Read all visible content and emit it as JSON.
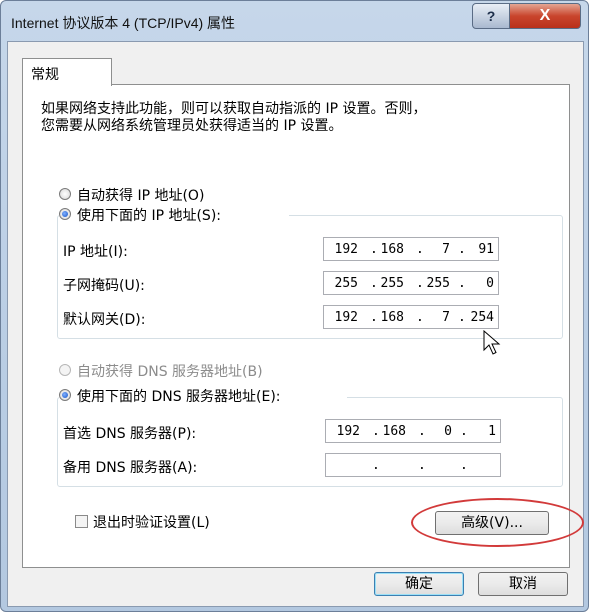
{
  "window": {
    "title": "Internet 协议版本 4 (TCP/IPv4) 属性",
    "help_label": "?",
    "close_label": "X"
  },
  "tab": {
    "general_label": "常规"
  },
  "intro_text": {
    "line1": "如果网络支持此功能，则可以获取自动指派的 IP 设置。否则，",
    "line2": "您需要从网络系统管理员处获得适当的 IP 设置。"
  },
  "ip_mode": {
    "auto_label": "自动获得 IP 地址(O)",
    "manual_label": "使用下面的 IP 地址(S):",
    "selected": "manual"
  },
  "ip_fields": {
    "ip_label": "IP 地址(I):",
    "ip_value": [
      "192",
      "168",
      "7",
      "91"
    ],
    "mask_label": "子网掩码(U):",
    "mask_value": [
      "255",
      "255",
      "255",
      "0"
    ],
    "gateway_label": "默认网关(D):",
    "gateway_value": [
      "192",
      "168",
      "7",
      "254"
    ]
  },
  "dns_mode": {
    "auto_label": "自动获得 DNS 服务器地址(B)",
    "manual_label": "使用下面的 DNS 服务器地址(E):",
    "selected": "manual"
  },
  "dns_fields": {
    "preferred_label": "首选 DNS 服务器(P):",
    "preferred_value": [
      "192",
      "168",
      "0",
      "1"
    ],
    "alternate_label": "备用 DNS 服务器(A):",
    "alternate_value": [
      "",
      "",
      "",
      ""
    ]
  },
  "validate": {
    "label": "退出时验证设置(L)",
    "checked": false
  },
  "buttons": {
    "advanced": "高级(V)...",
    "ok": "确定",
    "cancel": "取消"
  },
  "colors": {
    "highlight_ellipse": "#d23a3a",
    "title_gradient": "#b9cde4"
  }
}
